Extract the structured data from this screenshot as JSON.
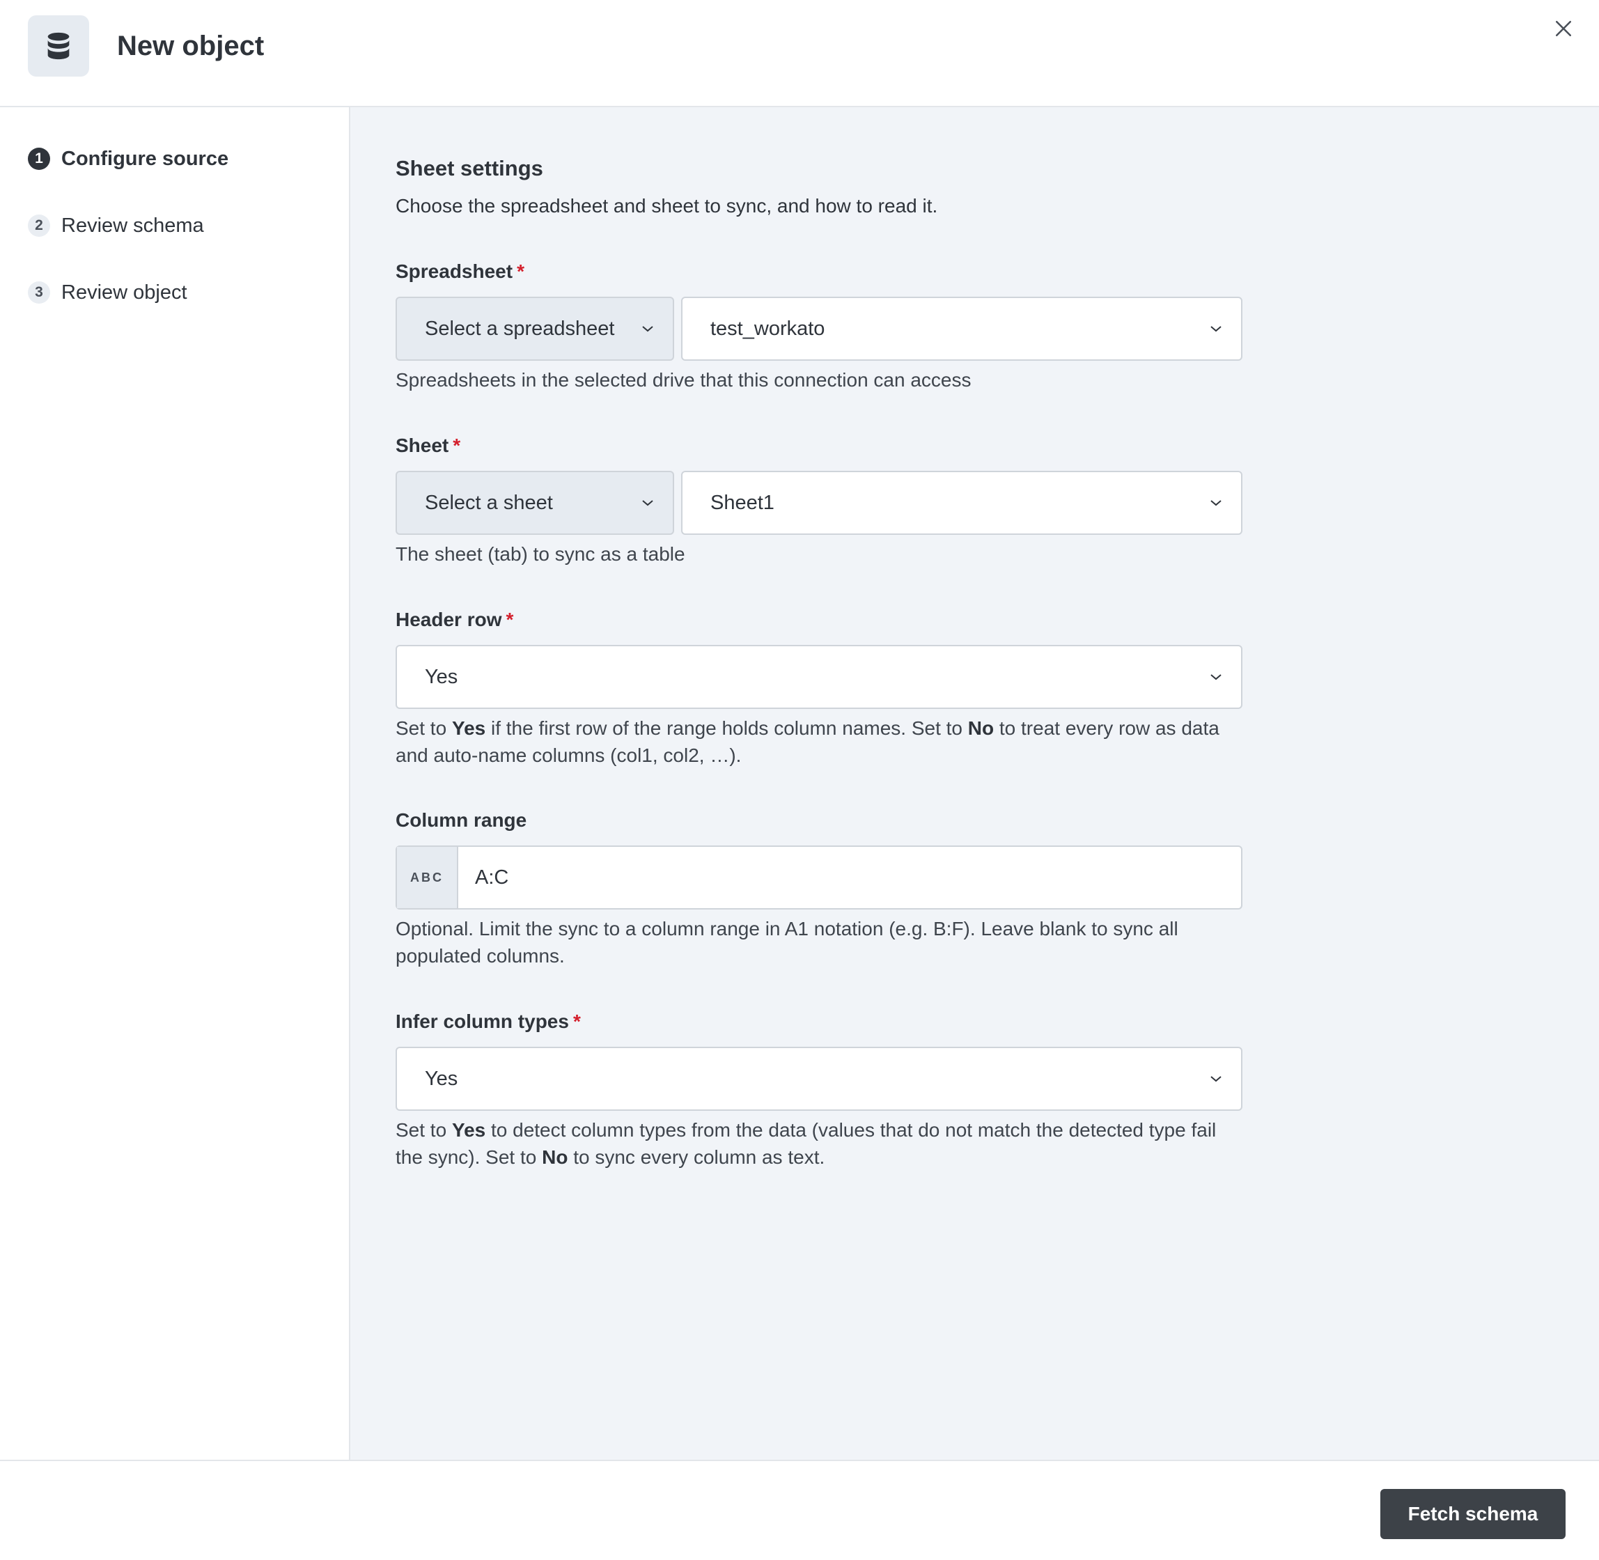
{
  "header": {
    "title": "New object",
    "icon": "database-icon"
  },
  "steps": [
    {
      "num": "1",
      "label": "Configure source",
      "active": true
    },
    {
      "num": "2",
      "label": "Review schema",
      "active": false
    },
    {
      "num": "3",
      "label": "Review object",
      "active": false
    }
  ],
  "section": {
    "title": "Sheet settings",
    "description": "Choose the spreadsheet and sheet to sync, and how to read it."
  },
  "fields": {
    "spreadsheet": {
      "label": "Spreadsheet",
      "required": "*",
      "mode": "Select a spreadsheet",
      "value": "test_workato",
      "help": "Spreadsheets in the selected drive that this connection can access"
    },
    "sheet": {
      "label": "Sheet",
      "required": "*",
      "mode": "Select a sheet",
      "value": "Sheet1",
      "help": "The sheet (tab) to sync as a table"
    },
    "header_row": {
      "label": "Header row",
      "required": "*",
      "value": "Yes",
      "help": {
        "t1": "Set to ",
        "b1": "Yes",
        "t2": " if the first row of the range holds column names. Set to ",
        "b2": "No",
        "t3": " to treat every row as data and auto-name columns (col1, col2, …)."
      }
    },
    "column_range": {
      "label": "Column range",
      "badge": "ABC",
      "value": "A:C",
      "help": "Optional. Limit the sync to a column range in A1 notation (e.g. B:F). Leave blank to sync all populated columns."
    },
    "infer_types": {
      "label": "Infer column types",
      "required": "*",
      "value": "Yes",
      "help": {
        "t1": "Set to ",
        "b1": "Yes",
        "t2": " to detect column types from the data (values that do not match the detected type fail the sync). Set to ",
        "b2": "No",
        "t3": " to sync every column as text."
      }
    }
  },
  "footer": {
    "primary_label": "Fetch schema"
  },
  "colors": {
    "required": "#d4202d",
    "primary_button": "#3d4248",
    "main_bg": "#f1f4f8"
  }
}
